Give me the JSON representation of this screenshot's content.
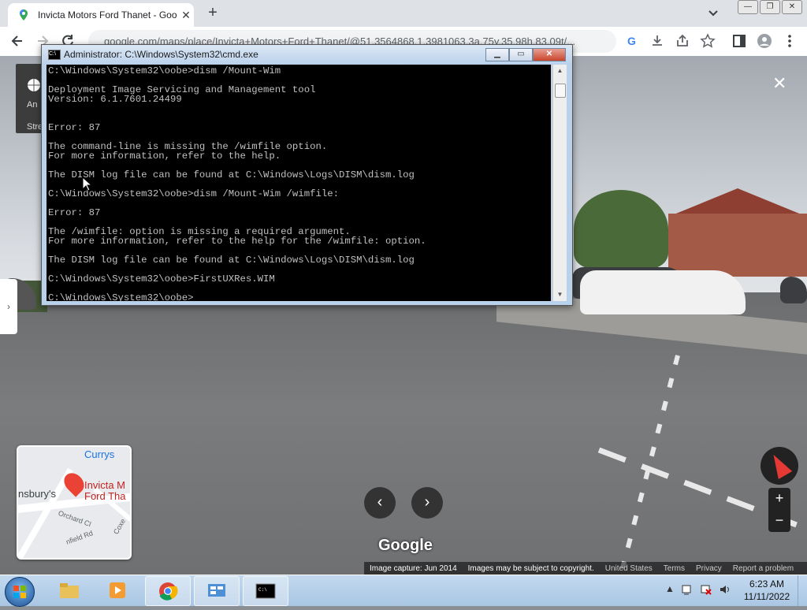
{
  "browser": {
    "tab_title": "Invicta Motors Ford Thanet - Goo",
    "new_tab": "+",
    "tab_close": "✕",
    "url": "google.com/maps/place/Invicta+Motors+Ford+Thanet/@51.3564868,1.3981063,3a,75y,35.98h,83.09t/...",
    "window_controls": [
      "—",
      "❐",
      "✕"
    ]
  },
  "cmd": {
    "title": "Administrator: C:\\Windows\\System32\\cmd.exe",
    "buttons": [
      "▁",
      "▭",
      "✕"
    ],
    "output": "C:\\Windows\\System32\\oobe>dism /Mount-Wim\n\nDeployment Image Servicing and Management tool\nVersion: 6.1.7601.24499\n\n\nError: 87\n\nThe command-line is missing the /wimfile option.\nFor more information, refer to the help.\n\nThe DISM log file can be found at C:\\Windows\\Logs\\DISM\\dism.log\n\nC:\\Windows\\System32\\oobe>dism /Mount-Wim /wimfile:\n\nError: 87\n\nThe /wimfile: option is missing a required argument.\nFor more information, refer to the help for the /wimfile: option.\n\nThe DISM log file can be found at C:\\Windows\\Logs\\DISM\\dism.log\n\nC:\\Windows\\System32\\oobe>FirstUXRes.WIM\n\nC:\\Windows\\System32\\oobe>"
  },
  "streetview": {
    "close": "✕",
    "left_card_top": "An",
    "left_card_bottom": "Stre",
    "side_arrow": "›",
    "google_logo": "Google",
    "attribution": {
      "capture": "Image capture: Jun 2014",
      "copyright": "Images may be subject to copyright.",
      "region": "United States",
      "terms": "Terms",
      "privacy": "Privacy",
      "report": "Report a problem"
    },
    "nav_prev": "‹",
    "nav_next": "›",
    "zoom_in": "+",
    "zoom_out": "−"
  },
  "minimap": {
    "currys": "Currys",
    "sainsburys": "nsbury's",
    "place_line1": "Invicta M",
    "place_line2": "Ford Tha",
    "street1": "Orchard Cl",
    "street2": "nfield Rd",
    "street3": "Coxe"
  },
  "taskbar": {
    "time": "6:23 AM",
    "date": "11/11/2022",
    "tray_arrow": "▲"
  },
  "colors": {
    "accent_red": "#e53935",
    "taskbar": "#b4cfe9"
  }
}
